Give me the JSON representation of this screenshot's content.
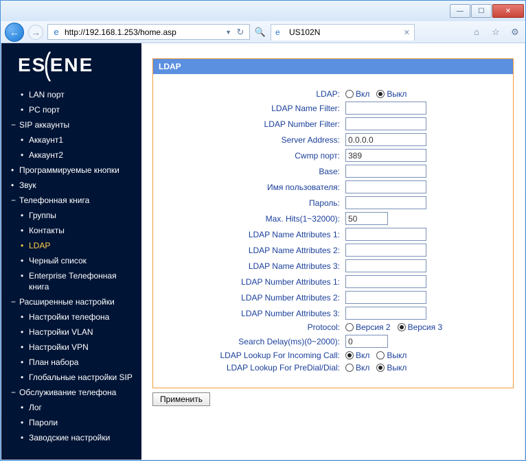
{
  "browser": {
    "url": "http://192.168.1.253/home.asp",
    "tab_title": "US102N"
  },
  "logo": {
    "text_left": "ES",
    "text_right": "ENE"
  },
  "sidebar": {
    "items": [
      {
        "label": "LAN порт",
        "level": "sub",
        "marker": "•"
      },
      {
        "label": "PC порт",
        "level": "sub",
        "marker": "•"
      },
      {
        "label": "SIP аккаунты",
        "level": "top",
        "marker": "−"
      },
      {
        "label": "Аккаунт1",
        "level": "sub",
        "marker": "•"
      },
      {
        "label": "Аккаунт2",
        "level": "sub",
        "marker": "•"
      },
      {
        "label": "Программируемые кнопки",
        "level": "top",
        "marker": "•"
      },
      {
        "label": "Звук",
        "level": "top",
        "marker": "•"
      },
      {
        "label": "Телефонная книга",
        "level": "top",
        "marker": "−"
      },
      {
        "label": "Группы",
        "level": "sub",
        "marker": "•"
      },
      {
        "label": "Контакты",
        "level": "sub",
        "marker": "•"
      },
      {
        "label": "LDAP",
        "level": "sub",
        "marker": "•",
        "hl": true
      },
      {
        "label": "Черный список",
        "level": "sub",
        "marker": "•"
      },
      {
        "label": "Enterprise Телефонная книга",
        "level": "sub",
        "marker": "•"
      },
      {
        "label": "Расширенные настройки",
        "level": "top",
        "marker": "−"
      },
      {
        "label": "Настройки телефона",
        "level": "sub",
        "marker": "•"
      },
      {
        "label": "Настройки VLAN",
        "level": "sub",
        "marker": "•"
      },
      {
        "label": "Настройки VPN",
        "level": "sub",
        "marker": "•"
      },
      {
        "label": "План набора",
        "level": "sub",
        "marker": "•"
      },
      {
        "label": "Глобальные настройки SIP",
        "level": "sub",
        "marker": "•"
      },
      {
        "label": "Обслуживание телефона",
        "level": "top",
        "marker": "−"
      },
      {
        "label": "Лог",
        "level": "sub",
        "marker": "•"
      },
      {
        "label": "Пароли",
        "level": "sub",
        "marker": "•"
      },
      {
        "label": "Заводские настройки",
        "level": "sub",
        "marker": "•"
      }
    ]
  },
  "panel": {
    "title": "LDAP",
    "fields": {
      "ldap_enable": {
        "label": "LDAP:",
        "opt_on": "Вкл",
        "opt_off": "Выкл",
        "value": "off"
      },
      "name_filter": {
        "label": "LDAP Name Filter:",
        "value": ""
      },
      "number_filter": {
        "label": "LDAP Number Filter:",
        "value": ""
      },
      "server_address": {
        "label": "Server Address:",
        "value": "0.0.0.0"
      },
      "cwmp_port": {
        "label": "Cwmp порт:",
        "value": "389"
      },
      "base": {
        "label": "Base:",
        "value": ""
      },
      "username": {
        "label": "Имя пользователя:",
        "value": ""
      },
      "password": {
        "label": "Пароль:",
        "value": ""
      },
      "max_hits": {
        "label": "Max. Hits(1~32000):",
        "value": "50"
      },
      "name_attr1": {
        "label": "LDAP Name Attributes 1:",
        "value": ""
      },
      "name_attr2": {
        "label": "LDAP Name Attributes 2:",
        "value": ""
      },
      "name_attr3": {
        "label": "LDAP Name Attributes 3:",
        "value": ""
      },
      "num_attr1": {
        "label": "LDAP Number Attributes 1:",
        "value": ""
      },
      "num_attr2": {
        "label": "LDAP Number Attributes 2:",
        "value": ""
      },
      "num_attr3": {
        "label": "LDAP Number Attributes 3:",
        "value": ""
      },
      "protocol": {
        "label": "Protocol:",
        "opt_v2": "Версия 2",
        "opt_v3": "Версия 3",
        "value": "v3"
      },
      "search_delay": {
        "label": "Search Delay(ms)(0~2000):",
        "value": "0"
      },
      "lookup_incoming": {
        "label": "LDAP Lookup For Incoming Call:",
        "opt_on": "Вкл",
        "opt_off": "Выкл",
        "value": "on"
      },
      "lookup_predial": {
        "label": "LDAP Lookup For PreDial/Dial:",
        "opt_on": "Вкл",
        "opt_off": "Выкл",
        "value": "off"
      }
    },
    "apply_label": "Применить"
  }
}
